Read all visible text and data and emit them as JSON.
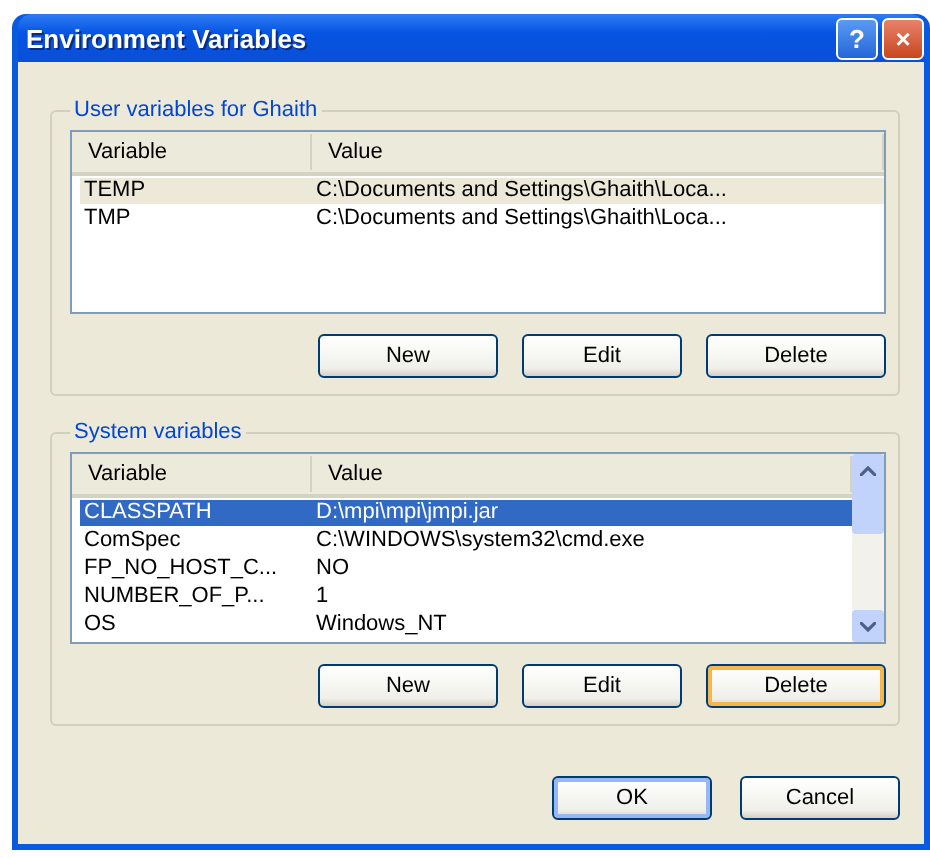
{
  "window": {
    "title": "Environment Variables",
    "controls": [
      "?",
      "×"
    ]
  },
  "groups": [
    {
      "label": "User variables for Ghaith",
      "focused": false,
      "columns": [
        "Variable",
        "Value"
      ],
      "rows": [
        {
          "variable": "TEMP",
          "value": "C:\\Documents and Settings\\Ghaith\\Loca...",
          "selected": true
        },
        {
          "variable": "TMP",
          "value": "C:\\Documents and Settings\\Ghaith\\Loca...",
          "selected": false
        }
      ],
      "scrollbar": false,
      "buttons": [
        {
          "label": "New",
          "focused": false
        },
        {
          "label": "Edit",
          "focused": false
        },
        {
          "label": "Delete",
          "focused": false
        }
      ]
    },
    {
      "label": "System variables",
      "focused": true,
      "columns": [
        "Variable",
        "Value"
      ],
      "rows": [
        {
          "variable": "CLASSPATH",
          "value": "D:\\mpi\\mpi\\jmpi.jar",
          "selected": true
        },
        {
          "variable": "ComSpec",
          "value": "C:\\WINDOWS\\system32\\cmd.exe",
          "selected": false
        },
        {
          "variable": "FP_NO_HOST_C...",
          "value": "NO",
          "selected": false
        },
        {
          "variable": "NUMBER_OF_P...",
          "value": "1",
          "selected": false
        },
        {
          "variable": "OS",
          "value": "Windows_NT",
          "selected": false
        }
      ],
      "scrollbar": true,
      "buttons": [
        {
          "label": "New",
          "focused": false
        },
        {
          "label": "Edit",
          "focused": false
        },
        {
          "label": "Delete",
          "focused": true
        }
      ]
    }
  ],
  "footer_buttons": [
    {
      "label": "OK",
      "default": true
    },
    {
      "label": "Cancel",
      "default": false
    }
  ]
}
